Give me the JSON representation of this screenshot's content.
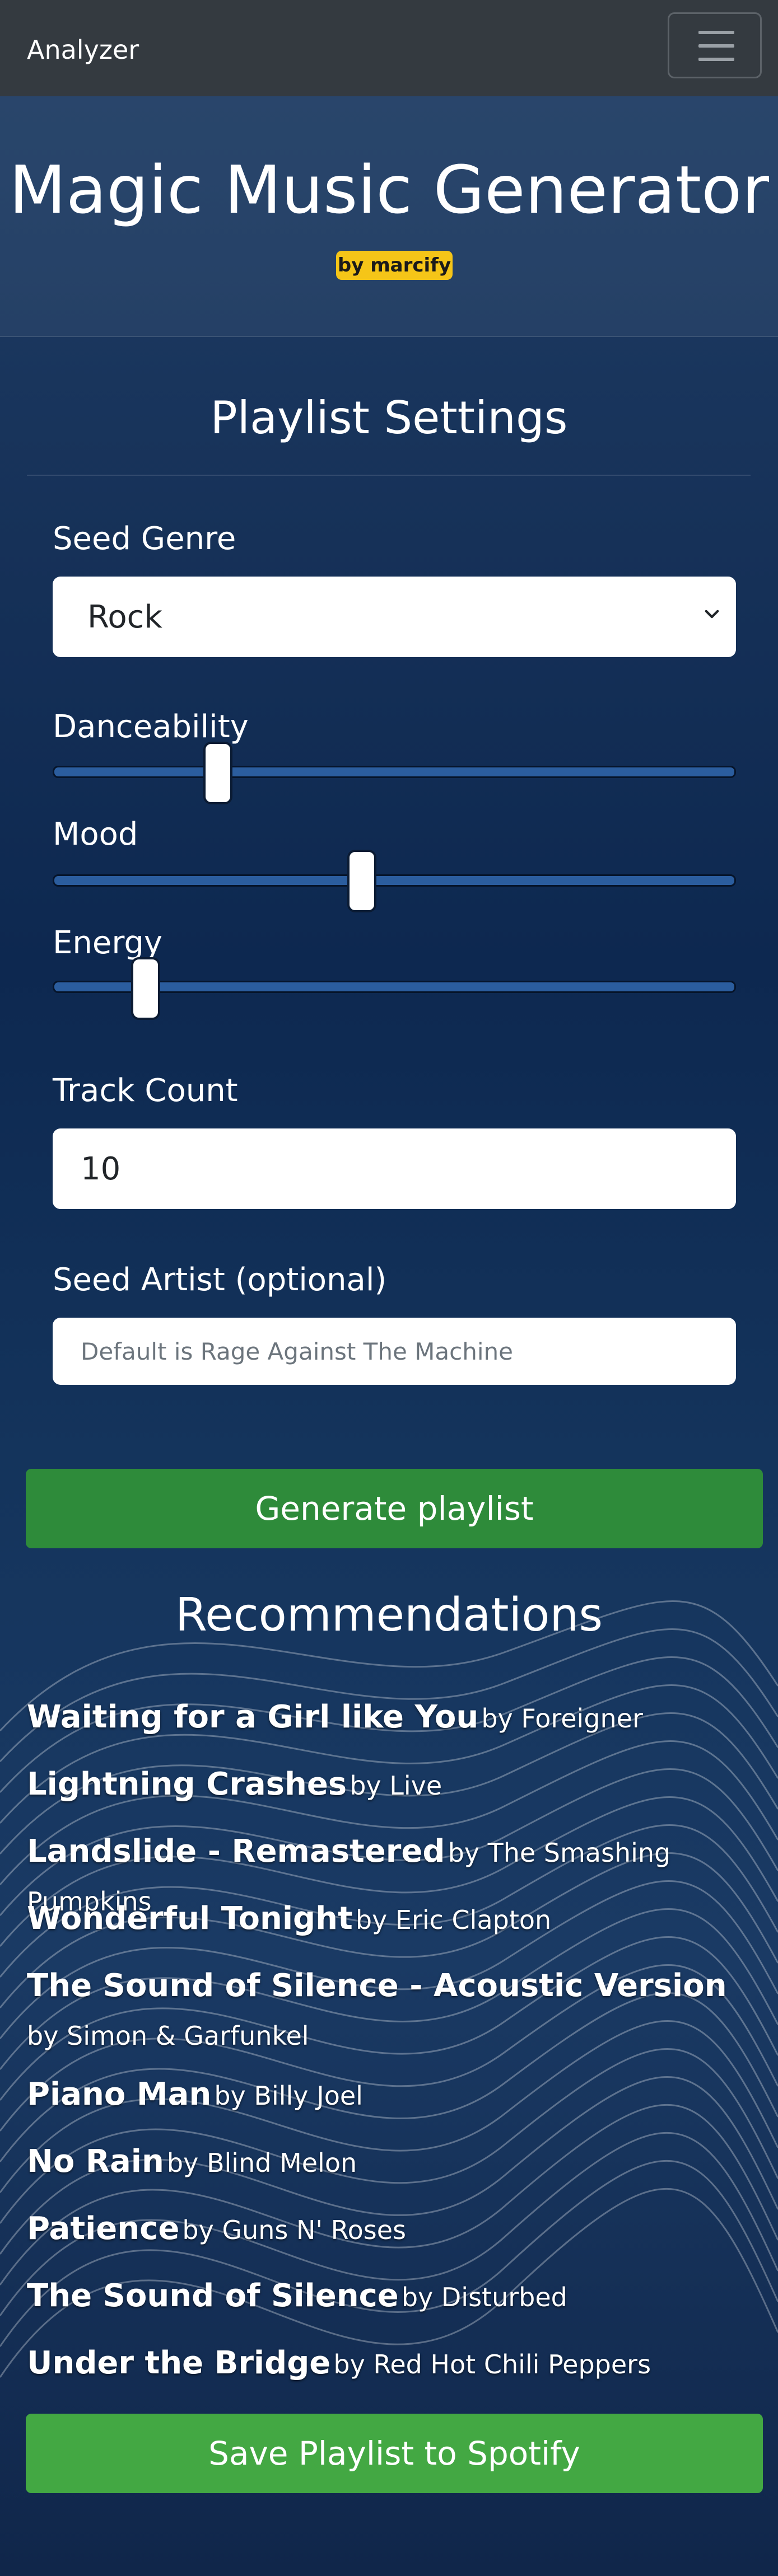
{
  "navbar": {
    "brand": "Analyzer",
    "menu_icon": "hamburger-menu-icon"
  },
  "header": {
    "title": "Magic Music Generator",
    "badge": "by marcify"
  },
  "settings": {
    "heading": "Playlist Settings",
    "genre": {
      "label": "Seed Genre",
      "value": "Rock",
      "icon": "chevron-down-icon"
    },
    "danceability": {
      "label": "Danceability",
      "value_fraction": 0.23
    },
    "mood": {
      "label": "Mood",
      "value_fraction": 0.45
    },
    "energy": {
      "label": "Energy",
      "value_fraction": 0.12
    },
    "track_count": {
      "label": "Track Count",
      "value": "10"
    },
    "seed_artist": {
      "label": "Seed Artist (optional)",
      "placeholder": "Default is Rage Against The Machine"
    }
  },
  "generate_label": "Generate playlist",
  "recommendations": {
    "heading": "Recommendations",
    "items": [
      {
        "song": "Waiting for a Girl like You",
        "by": "by Foreigner"
      },
      {
        "song": "Lightning Crashes",
        "by": "by Live"
      },
      {
        "song": "Landslide - Remastered",
        "by": "by The Smashing Pumpkins"
      },
      {
        "song": "Wonderful Tonight",
        "by": "by Eric Clapton"
      },
      {
        "song": "The Sound of Silence - Acoustic Version",
        "by": "by Simon & Garfunkel"
      },
      {
        "song": "Piano Man",
        "by": "by Billy Joel"
      },
      {
        "song": "No Rain",
        "by": "by Blind Melon"
      },
      {
        "song": "Patience",
        "by": "by Guns N' Roses"
      },
      {
        "song": "The Sound of Silence",
        "by": "by Disturbed"
      },
      {
        "song": "Under the Bridge",
        "by": "by Red Hot Chili Peppers"
      }
    ]
  },
  "save_label": "Save Playlist to Spotify",
  "colors": {
    "navbar": "#343a40",
    "badge": "#f5c518",
    "generate_button": "#2e8b3a",
    "save_button": "#43a843",
    "slider_track": "#2b5d9e",
    "background": "#0c2448"
  }
}
